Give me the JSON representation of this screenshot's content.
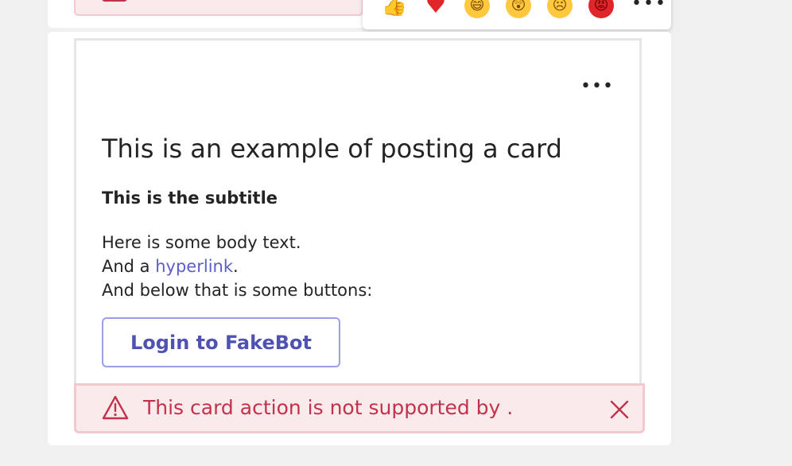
{
  "reactions": {
    "items": [
      {
        "name": "like",
        "glyph": "👍"
      },
      {
        "name": "heart",
        "glyph": "♥"
      },
      {
        "name": "laugh",
        "glyph": "😄"
      },
      {
        "name": "surprised",
        "glyph": "😲"
      },
      {
        "name": "sad",
        "glyph": "☹"
      },
      {
        "name": "angry",
        "glyph": "😡"
      }
    ],
    "more": "•••"
  },
  "card": {
    "more": "•••",
    "title": "This is an example of posting a card",
    "subtitle": "This is the subtitle",
    "body_line1": "Here is some body text.",
    "body_line2_prefix": "And a ",
    "body_link": "hyperlink",
    "body_line2_suffix": ".",
    "body_line3": "And below that is some buttons:",
    "button_label": "Login to FakeBot"
  },
  "error": {
    "message": "This card action is not supported by .",
    "icon": "warning-icon",
    "close_icon": "close-icon",
    "color": "#c4314b"
  },
  "colors": {
    "accent": "#5b5fc7",
    "button_border": "#9d9ee7",
    "error_bg": "#f9eaec",
    "error_border": "#f2c9cf"
  }
}
